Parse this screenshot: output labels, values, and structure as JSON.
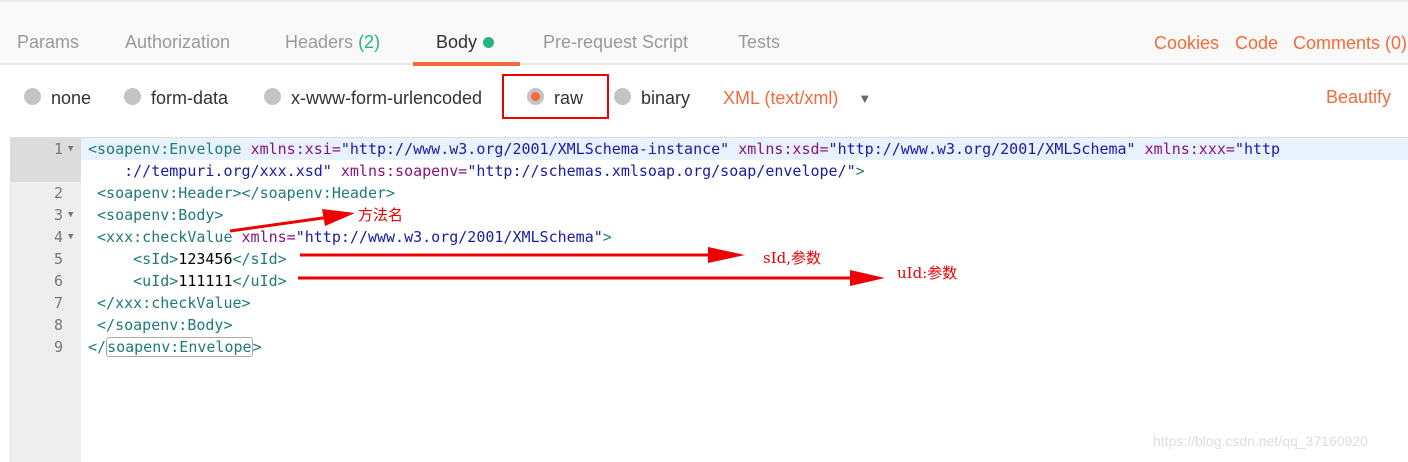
{
  "tabs": [
    {
      "label": "Params"
    },
    {
      "label": "Authorization"
    },
    {
      "label": "Headers",
      "badge": "(2)"
    },
    {
      "label": "Body"
    },
    {
      "label": "Pre-request Script"
    },
    {
      "label": "Tests"
    }
  ],
  "right_links": {
    "cookies": "Cookies",
    "code": "Code",
    "comments": "Comments (0)"
  },
  "body_types": [
    "none",
    "form-data",
    "x-www-form-urlencoded",
    "raw",
    "binary"
  ],
  "selected_type": "raw",
  "content_type": "XML (text/xml)",
  "beautify": "Beautify",
  "colors": {
    "accent": "#f26b3a",
    "green": "#26b47f",
    "annotation": "#ee0000"
  },
  "lines": [
    {
      "n": "1",
      "a": "<soapenv:Envelope ",
      "b": "xmlns:xsi=",
      "c": "\"http://www.w3.org/2001/XMLSchema-instance\" ",
      "d": "xmlns:xsd=",
      "e": "\"http://www.w3.org/2001/XMLSchema\" ",
      "f": "xmlns:xxx=",
      "g": "\"http"
    },
    {
      "n": "",
      "a": "    ",
      "g": "://tempuri.org/xxx.xsd\" ",
      "f": "xmlns:soapenv=",
      "e": "\"http://schemas.xmlsoap.org/soap/envelope/\"",
      "h": ">"
    },
    {
      "n": "2",
      "a": " <soapenv:Header></soapenv:Header>"
    },
    {
      "n": "3",
      "a": " <soapenv:Body>"
    },
    {
      "n": "4",
      "a": " <xxx:checkValue ",
      "b": "xmlns=",
      "c": "\"http://www.w3.org/2001/XMLSchema\"",
      "d": ">"
    },
    {
      "n": "5",
      "a": "     <sId>",
      "b": "123456",
      "c": "</sId>"
    },
    {
      "n": "6",
      "a": "     <uId>",
      "b": "111111",
      "c": "</uId>"
    },
    {
      "n": "7",
      "a": " </xxx:checkValue>"
    },
    {
      "n": "8",
      "a": " </soapenv:Body>"
    },
    {
      "n": "9",
      "a": "</",
      "b": "soapenv:Envelope",
      "c": ">"
    }
  ],
  "annotations": {
    "method": "方法名",
    "sid": "sId,参数",
    "uid": "uId:参数"
  },
  "watermark": "https://blog.csdn.net/qq_37160920"
}
